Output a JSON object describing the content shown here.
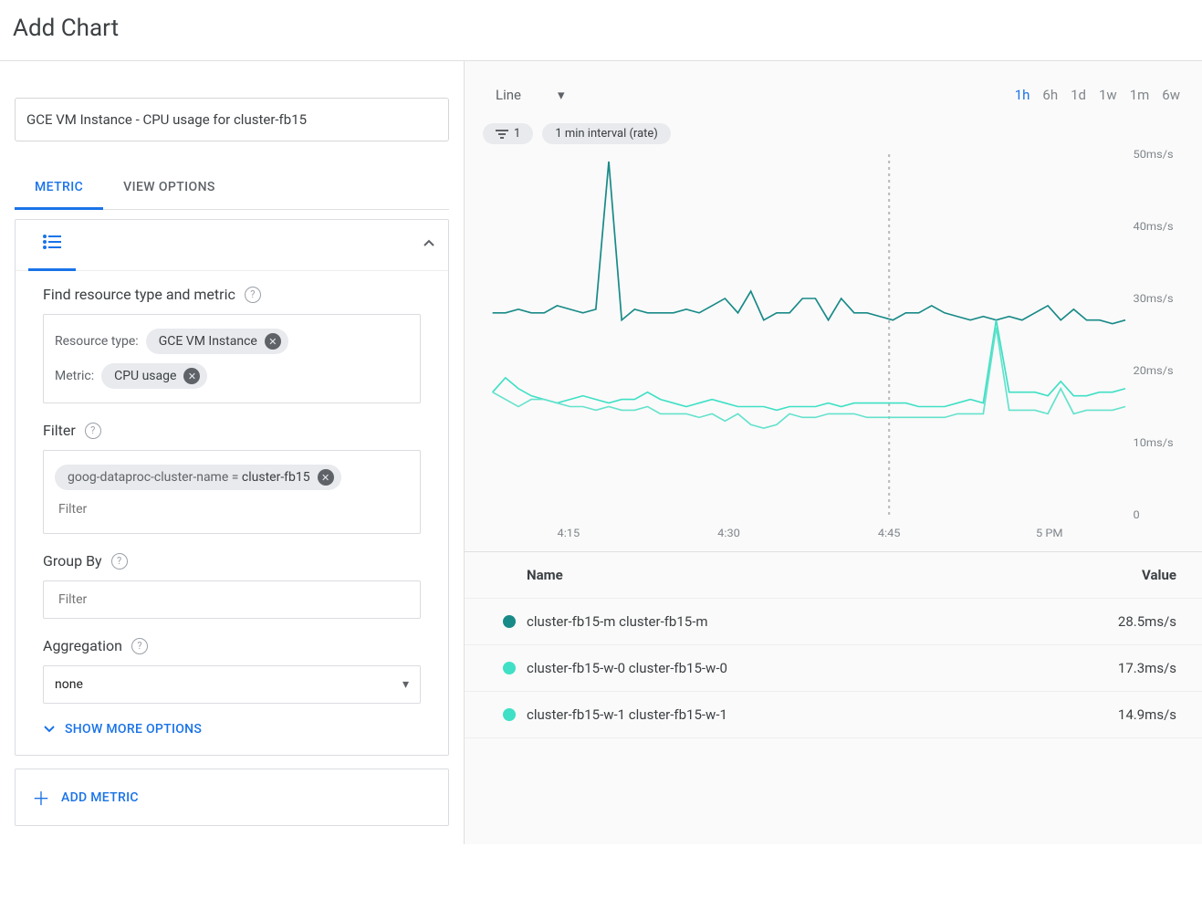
{
  "page_title": "Add Chart",
  "chart_title_input": "GCE VM Instance - CPU usage for cluster-fb15",
  "tabs": {
    "metric": "METRIC",
    "view_options": "VIEW OPTIONS",
    "active": "metric"
  },
  "metric_panel": {
    "find_title": "Find resource type and metric",
    "resource_type_label": "Resource type:",
    "resource_type_chip": "GCE VM Instance",
    "metric_label": "Metric:",
    "metric_chip": "CPU usage",
    "filter_title": "Filter",
    "filter_chip_key": "goog-dataproc-cluster-name = ",
    "filter_chip_val": "cluster-fb15",
    "filter_placeholder": "Filter",
    "groupby_title": "Group By",
    "groupby_placeholder": "Filter",
    "aggregation_title": "Aggregation",
    "aggregation_value": "none",
    "show_more": "SHOW MORE OPTIONS",
    "add_metric": "ADD METRIC"
  },
  "chart_top": {
    "type_select": "Line",
    "ranges": [
      "1h",
      "6h",
      "1d",
      "1w",
      "1m",
      "6w"
    ],
    "active_range": "1h",
    "filter_count": "1",
    "interval_pill": "1 min interval (rate)"
  },
  "legend": {
    "name_header": "Name",
    "value_header": "Value",
    "rows": [
      {
        "color": "#188a87",
        "name": "cluster-fb15-m cluster-fb15-m",
        "value": "28.5ms/s"
      },
      {
        "color": "#3fe0c5",
        "name": "cluster-fb15-w-0 cluster-fb15-w-0",
        "value": "17.3ms/s"
      },
      {
        "color": "#3fe0c5",
        "name": "cluster-fb15-w-1 cluster-fb15-w-1",
        "value": "14.9ms/s"
      }
    ]
  },
  "chart_data": {
    "type": "line",
    "title": "CPU usage",
    "xlabel": "",
    "ylabel": "ms/s",
    "x_ticks": [
      "4:15",
      "4:30",
      "4:45",
      "5 PM"
    ],
    "y_ticks": [
      0,
      "10ms/s",
      "20ms/s",
      "30ms/s",
      "40ms/s",
      "50ms/s"
    ],
    "ylim": [
      0,
      50
    ],
    "cursor_x": "4:45",
    "series": [
      {
        "name": "cluster-fb15-m",
        "color": "#188a87",
        "values": [
          28,
          28,
          28.5,
          28,
          28,
          29,
          28.5,
          28,
          28.5,
          49,
          27,
          28.5,
          28,
          28,
          28,
          28.5,
          28,
          29,
          30,
          28,
          31,
          27,
          28,
          28,
          30,
          30,
          27,
          30,
          28,
          28,
          27.5,
          27,
          28,
          28,
          29,
          28,
          27.5,
          27,
          27.5,
          27,
          27.5,
          27,
          28,
          29,
          27,
          28.5,
          27,
          27,
          26.5,
          27
        ]
      },
      {
        "name": "cluster-fb15-w-0",
        "color": "#3fe0c5",
        "values": [
          17,
          19,
          17.5,
          16.5,
          16,
          15.5,
          16,
          16.5,
          16,
          15.5,
          16,
          16,
          17,
          16,
          15.5,
          15,
          15.5,
          16,
          15.5,
          15,
          15,
          15,
          14.5,
          15,
          15,
          15,
          15.5,
          15,
          15.5,
          15.5,
          15.5,
          15.5,
          15.5,
          15,
          15,
          15,
          15.5,
          16,
          15.5,
          27,
          17,
          17,
          17,
          16.5,
          18.5,
          16.5,
          16.5,
          17,
          17,
          17.5
        ]
      },
      {
        "name": "cluster-fb15-w-1",
        "color": "#64e2cc",
        "values": [
          17,
          16,
          15,
          16,
          16,
          15.5,
          15,
          15,
          14.5,
          15,
          14.5,
          14.5,
          15,
          14,
          14,
          14,
          13.5,
          14,
          13,
          14,
          12.5,
          12,
          12.5,
          14,
          13.5,
          13.5,
          14,
          14,
          14,
          13.5,
          13.5,
          13.5,
          13.5,
          13.5,
          13.5,
          13.5,
          14,
          14,
          14,
          26,
          14.5,
          14.5,
          14.5,
          14,
          17.5,
          14,
          14.5,
          14.5,
          14.5,
          15
        ]
      }
    ]
  }
}
